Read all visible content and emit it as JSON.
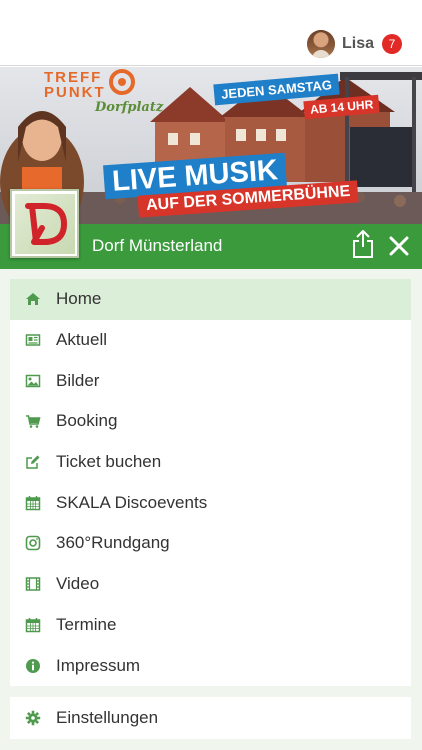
{
  "header": {
    "username": "Lisa",
    "notification_count": "7"
  },
  "banner": {
    "brand_line1": "TREFF",
    "brand_line2": "PUNKT",
    "brand_script": "Dorfplatz",
    "tag_day": "JEDEN SAMSTAG",
    "tag_time": "AB 14 UHR",
    "headline": "LIVE MUSIK",
    "subline": "AUF DER SOMMERBÜHNE"
  },
  "club": {
    "title": "Dorf Münsterland",
    "logo_letter": "D"
  },
  "menu": {
    "items": [
      {
        "label": "Home",
        "icon": "home-icon",
        "active": true
      },
      {
        "label": "Aktuell",
        "icon": "newspaper-icon"
      },
      {
        "label": "Bilder",
        "icon": "image-icon"
      },
      {
        "label": "Booking",
        "icon": "cart-icon"
      },
      {
        "label": "Ticket buchen",
        "icon": "edit-icon"
      },
      {
        "label": "SKALA Discoevents",
        "icon": "calendar-icon"
      },
      {
        "label": "360°Rundgang",
        "icon": "instagram-icon"
      },
      {
        "label": "Video",
        "icon": "film-icon"
      },
      {
        "label": "Termine",
        "icon": "calendar-icon"
      },
      {
        "label": "Impressum",
        "icon": "info-icon"
      }
    ],
    "settings_label": "Einstellungen"
  },
  "colors": {
    "accent": "#3a9a3c",
    "icon": "#4f9a4f",
    "active_bg": "#dbeed8",
    "badge": "#e12a26"
  }
}
